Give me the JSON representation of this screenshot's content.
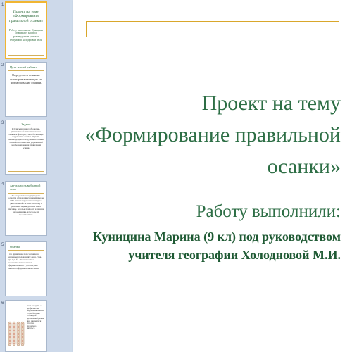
{
  "slide": {
    "title": "Проект на тему «Формирование правильной осанки»",
    "author_label": "Работу выполнили:",
    "author_name": "Куницина Марина (9 кл) под руководством учителя географии Холодновой М.И."
  },
  "thumbnails": [
    {
      "number": "1",
      "title": "Проект на тему «Формирование правильной осанки»",
      "text": "Работу выполнили: Куницина Марина (9 кл) под руководством учителя географии Холодновой М.И."
    },
    {
      "number": "2",
      "title": "Цель нашей работы:",
      "text": "Определить влияние факторов влияющих на формирование осанки."
    },
    {
      "number": "3",
      "title": "Задачи:",
      "text": "Изучить материал об опорно-двигательной системе человека. Выявить факторы, способствующие нарушению осанки. Изучить рекомендации по нарушению осанки. Разработать комплекс упражнений для формирования правильной осанки."
    },
    {
      "number": "4",
      "title": "Актуальность выбранной темы",
      "text": "По результатам медицинского осмотра обучающихся нашей школы 60% имеют нарушения в опорно-двигательной системе. Поэтому к решению задачи должны знать причины, которые приводят к данным заболеваниям, и методы их профилактики."
    },
    {
      "number": "5",
      "title": "Осанка",
      "text": "- это привычная поза человека в различных положениях: сидя, стоя, при ходьбе. Это привычное положение тела человека, сформированное с детства; она зависит от формы позвоночника."
    },
    {
      "number": "6",
      "title": "",
      "text": "Если говорить о профилактике нарушения осанки, то необходимо соблюдать правильный режим дня, заниматься спортом, правильно питаться."
    }
  ]
}
